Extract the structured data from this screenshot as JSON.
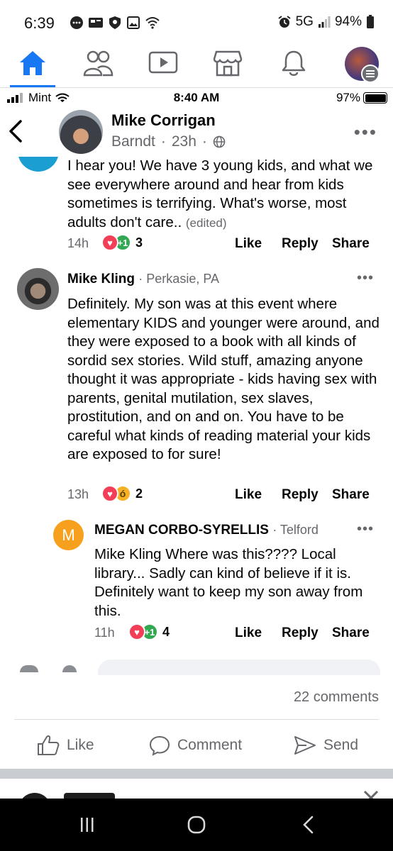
{
  "android_status": {
    "time": "6:39",
    "network": "5G",
    "battery": "94%"
  },
  "fb_nav": {
    "tabs": [
      "home-icon",
      "friends-icon",
      "watch-icon",
      "marketplace-icon",
      "notifications-icon",
      "profile-avatar"
    ],
    "active_color": "#1877f2"
  },
  "ios_status": {
    "carrier": "Mint",
    "time": "8:40 AM",
    "battery": "97%"
  },
  "post": {
    "author": "Mike Corrigan",
    "group": "Barndt",
    "age": "23h",
    "sep": "·"
  },
  "comments": [
    {
      "text": "I hear you! We have 3 young kids, and what we see everywhere around and hear from kids sometimes is terrifying. What's worse, most adults don't care..",
      "edited": "(edited)",
      "time": "14h",
      "reaction_count": "3",
      "like": "Like",
      "reply": "Reply",
      "share": "Share"
    },
    {
      "name": "Mike Kling",
      "location": "· Perkasie, PA",
      "text": "Definitely. My son was at this event where elementary KIDS and younger were around, and they were exposed to a book with all kinds of sordid sex stories. Wild stuff, amazing anyone thought it was appropriate - kids having sex with parents, genital mutilation, sex slaves, prostitution, and on and on.  You have to be careful what kinds of reading material your kids are exposed to for sure!",
      "time": "13h",
      "reaction_count": "2",
      "like": "Like",
      "reply": "Reply",
      "share": "Share"
    },
    {
      "name": "MEGAN CORBO-SYRELLIS",
      "location": "· Telford",
      "avatar_letter": "M",
      "text": "Mike Kling Where was this???? Local library... Sadly can kind of believe if it is. Definitely want to keep my son away from this.",
      "time": "11h",
      "reaction_count": "4",
      "like": "Like",
      "reply": "Reply",
      "share": "Share"
    }
  ],
  "more_glyph": "•••",
  "plus_one": "+1",
  "footer": {
    "comments_count": "22 comments",
    "like": "Like",
    "comment": "Comment",
    "send": "Send"
  }
}
